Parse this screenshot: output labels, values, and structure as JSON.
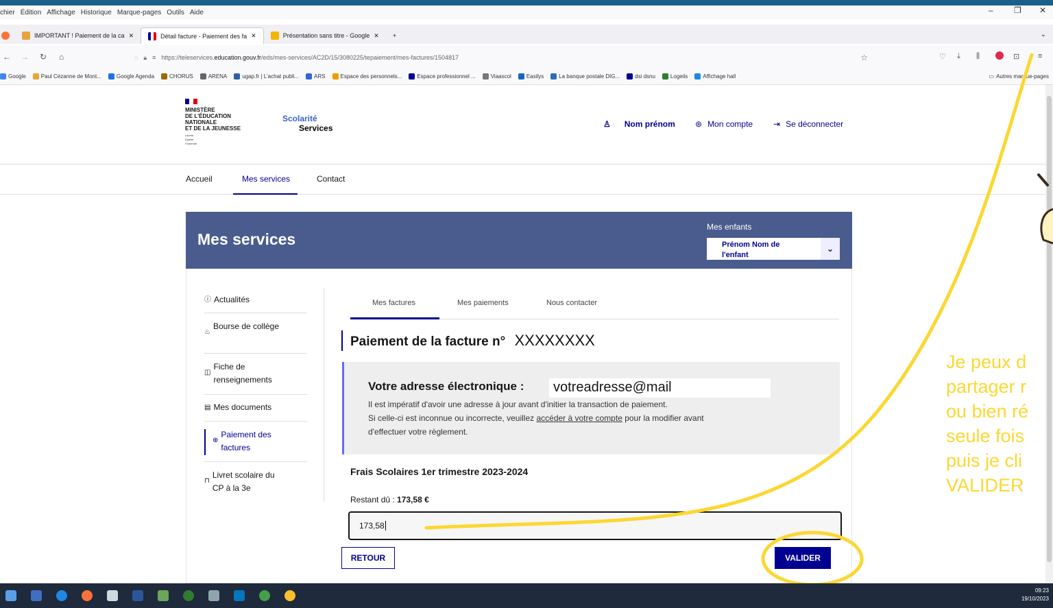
{
  "browser": {
    "menu": [
      "chier",
      "Édition",
      "Affichage",
      "Historique",
      "Marque-pages",
      "Outils",
      "Aide"
    ],
    "tabs": [
      {
        "label": "IMPORTANT ! Paiement de la ca",
        "active": false,
        "color": "#e8a33c"
      },
      {
        "label": "Détail facture - Paiement des fa",
        "active": true,
        "color": "#000091"
      },
      {
        "label": "Présentation sans titre - Google",
        "active": false,
        "color": "#f4b400"
      }
    ],
    "url_prefix": "https://teleservices.",
    "url_domain": "education.gouv.fr",
    "url_suffix": "/eds/mes-services/AC2D/15/3080225/tepaiement/mes-factures/1504817",
    "bookmarks": [
      "Google",
      "Paul Cézanne de Mont...",
      "Google Agenda",
      "CHORUS",
      "ARENA",
      "ugap.fr | L'achat publi...",
      "ARS",
      "Espace des personnels...",
      "Espace professionnel ...",
      "Viaascol",
      "Easilys",
      "La banque postale DIG...",
      "dsi dsnu",
      "Logeils",
      "Affichage hall"
    ],
    "other_bookmarks": "Autres marque-pages"
  },
  "site": {
    "ministry": [
      "MINISTÈRE",
      "DE L'ÉDUCATION",
      "NATIONALE",
      "ET DE LA JEUNESSE"
    ],
    "motto": "Liberté Égalité Fraternité",
    "brand_line1": "Scolarité",
    "brand_line2": "Services",
    "user_name": "Nom prénom",
    "account": "Mon compte",
    "logout": "Se déconnecter",
    "nav": [
      "Accueil",
      "Mes services",
      "Contact"
    ],
    "nav_active": "Mes services"
  },
  "banner": {
    "title": "Mes services",
    "children_label": "Mes enfants",
    "child_selected": "Prénom Nom de l'enfant"
  },
  "sidebar": [
    {
      "icon": "info-icon",
      "label": "Actualités"
    },
    {
      "icon": "scholarship-icon",
      "label": "Bourse de collège"
    },
    {
      "icon": "form-icon",
      "label": "Fiche de renseignements"
    },
    {
      "icon": "documents-icon",
      "label": "Mes documents"
    },
    {
      "icon": "payment-icon",
      "label": "Paiement des factures",
      "active": true
    },
    {
      "icon": "book-icon",
      "label": "Livret scolaire du CP à la 3e"
    }
  ],
  "content": {
    "tabs": [
      "Mes factures",
      "Mes paiements",
      "Nous contacter"
    ],
    "active_tab": "Mes factures",
    "heading": "Paiement de la facture n°",
    "invoice_number": "XXXXXXXX",
    "email_label": "Votre adresse électronique :",
    "email_value": "votreadresse@mail",
    "notice_line1": "Il est impératif d'avoir une adresse à jour avant d'initier la transaction de paiement.",
    "notice_line2a": "Si celle-ci est inconnue ou incorrecte, veuillez ",
    "notice_link": "accéder à votre compte",
    "notice_line2b": " pour la modifier avant",
    "notice_line3": "d'effectuer votre règlement.",
    "fees_title": "Frais Scolaires 1er trimestre 2023-2024",
    "remaining_label": "Restant dû : ",
    "remaining_value": "173,58 €",
    "amount_value": "173,58",
    "back_button": "RETOUR",
    "validate_button": "VALIDER"
  },
  "annotation": [
    "Je peux d",
    "partager r",
    "ou bien ré",
    "seule fois",
    "puis je cli",
    "VALIDER"
  ],
  "taskbar": {
    "time": "09:23",
    "date": "19/10/2023"
  },
  "colors": {
    "brand_blue": "#000091",
    "banner": "#4a5c8e",
    "annotation": "#fcd732"
  }
}
